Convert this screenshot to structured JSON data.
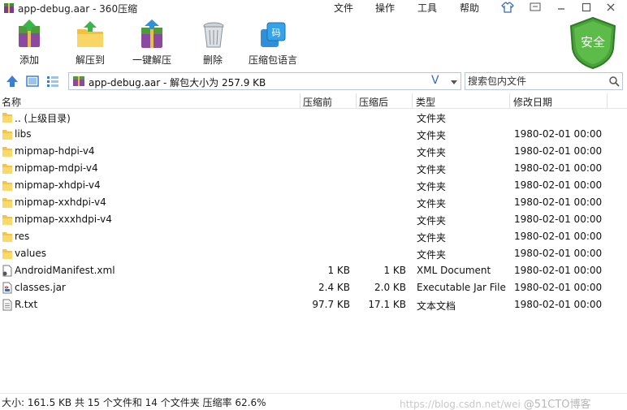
{
  "window": {
    "title": "app-debug.aar - 360压缩",
    "menu": [
      "文件",
      "操作",
      "工具",
      "帮助"
    ]
  },
  "toolbar": {
    "items": [
      {
        "label": "添加",
        "icon": "add-archive-icon"
      },
      {
        "label": "解压到",
        "icon": "extract-folder-icon"
      },
      {
        "label": "一键解压",
        "icon": "one-click-extract-icon"
      },
      {
        "label": "删除",
        "icon": "trash-icon"
      },
      {
        "label": "压缩包语言",
        "icon": "archive-language-icon"
      }
    ],
    "safety_badge": "安全"
  },
  "address": {
    "path": "app-debug.aar - 解包大小为 257.9 KB",
    "verify_glyph": "V",
    "search_placeholder": "搜索包内文件"
  },
  "columns": {
    "name": "名称",
    "packed": "压缩前",
    "unpacked": "压缩后",
    "type": "类型",
    "modified": "修改日期"
  },
  "files": [
    {
      "name": ".. (上级目录)",
      "packed": "",
      "unpacked": "",
      "type": "文件夹",
      "date": "",
      "icon": "folder"
    },
    {
      "name": "libs",
      "packed": "",
      "unpacked": "",
      "type": "文件夹",
      "date": "1980-02-01 00:00",
      "icon": "folder"
    },
    {
      "name": "mipmap-hdpi-v4",
      "packed": "",
      "unpacked": "",
      "type": "文件夹",
      "date": "1980-02-01 00:00",
      "icon": "folder"
    },
    {
      "name": "mipmap-mdpi-v4",
      "packed": "",
      "unpacked": "",
      "type": "文件夹",
      "date": "1980-02-01 00:00",
      "icon": "folder"
    },
    {
      "name": "mipmap-xhdpi-v4",
      "packed": "",
      "unpacked": "",
      "type": "文件夹",
      "date": "1980-02-01 00:00",
      "icon": "folder"
    },
    {
      "name": "mipmap-xxhdpi-v4",
      "packed": "",
      "unpacked": "",
      "type": "文件夹",
      "date": "1980-02-01 00:00",
      "icon": "folder"
    },
    {
      "name": "mipmap-xxxhdpi-v4",
      "packed": "",
      "unpacked": "",
      "type": "文件夹",
      "date": "1980-02-01 00:00",
      "icon": "folder"
    },
    {
      "name": "res",
      "packed": "",
      "unpacked": "",
      "type": "文件夹",
      "date": "1980-02-01 00:00",
      "icon": "folder"
    },
    {
      "name": "values",
      "packed": "",
      "unpacked": "",
      "type": "文件夹",
      "date": "1980-02-01 00:00",
      "icon": "folder"
    },
    {
      "name": "AndroidManifest.xml",
      "packed": "1 KB",
      "unpacked": "1 KB",
      "type": "XML Document",
      "date": "1980-02-01 00:00",
      "icon": "xml"
    },
    {
      "name": "classes.jar",
      "packed": "2.4 KB",
      "unpacked": "2.0 KB",
      "type": "Executable Jar File",
      "date": "1980-02-01 00:00",
      "icon": "jar"
    },
    {
      "name": "R.txt",
      "packed": "97.7 KB",
      "unpacked": "17.1 KB",
      "type": "文本文档",
      "date": "1980-02-01 00:00",
      "icon": "txt"
    }
  ],
  "status": {
    "text": "大小: 161.5 KB 共 15 个文件和 14 个文件夹 压缩率 62.6%",
    "watermark_url": "https://blog.csdn.net/wei",
    "watermark_brand": "@51CTO博客"
  },
  "colors": {
    "folder": "#f5c542",
    "accent": "#3b6cb7",
    "shield": "#4aa23a"
  }
}
